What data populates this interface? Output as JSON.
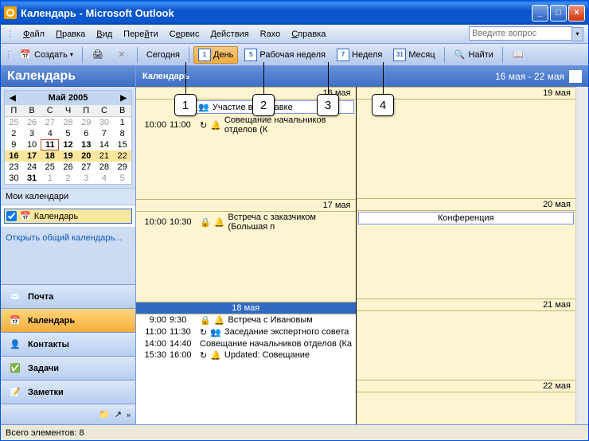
{
  "title": "Календарь - Microsoft Outlook",
  "menu": {
    "file": "Файл",
    "edit": "Правка",
    "view": "Вид",
    "go": "Перейти",
    "service": "Сервис",
    "actions": "Действия",
    "raxo": "Rахо",
    "help": "Справка"
  },
  "help_placeholder": "Введите вопрос",
  "toolbar": {
    "create": "Создать",
    "today": "Сегодня",
    "day_num": "1",
    "day": "День",
    "week5_num": "5",
    "workweek": "Рабочая неделя",
    "week7_num": "7",
    "week": "Неделя",
    "month_num": "31",
    "month": "Месяц",
    "find": "Найти"
  },
  "nav": {
    "header": "Календарь",
    "month": "Май 2005",
    "dow": [
      "П",
      "В",
      "С",
      "Ч",
      "П",
      "С",
      "В"
    ],
    "rows": [
      [
        {
          "d": "25",
          "dim": true
        },
        {
          "d": "26",
          "dim": true
        },
        {
          "d": "27",
          "dim": true
        },
        {
          "d": "28",
          "dim": true
        },
        {
          "d": "29",
          "dim": true
        },
        {
          "d": "30",
          "dim": true
        },
        {
          "d": "1"
        }
      ],
      [
        {
          "d": "2"
        },
        {
          "d": "3"
        },
        {
          "d": "4"
        },
        {
          "d": "5"
        },
        {
          "d": "6"
        },
        {
          "d": "7"
        },
        {
          "d": "8"
        }
      ],
      [
        {
          "d": "9"
        },
        {
          "d": "10"
        },
        {
          "d": "11",
          "today": true,
          "busy": true
        },
        {
          "d": "12",
          "busy": true
        },
        {
          "d": "13",
          "busy": true
        },
        {
          "d": "14"
        },
        {
          "d": "15"
        }
      ],
      [
        {
          "d": "16",
          "hl": true,
          "busy": true
        },
        {
          "d": "17",
          "hl": true,
          "busy": true
        },
        {
          "d": "18",
          "hl": true,
          "busy": true
        },
        {
          "d": "19",
          "hl": true,
          "busy": true
        },
        {
          "d": "20",
          "hl": true,
          "busy": true
        },
        {
          "d": "21",
          "hl": true
        },
        {
          "d": "22",
          "hl": true
        }
      ],
      [
        {
          "d": "23"
        },
        {
          "d": "24"
        },
        {
          "d": "25"
        },
        {
          "d": "26"
        },
        {
          "d": "27"
        },
        {
          "d": "28"
        },
        {
          "d": "29"
        }
      ],
      [
        {
          "d": "30"
        },
        {
          "d": "31",
          "busy": true
        },
        {
          "d": "1",
          "dim": true
        },
        {
          "d": "2",
          "dim": true
        },
        {
          "d": "3",
          "dim": true
        },
        {
          "d": "4",
          "dim": true
        },
        {
          "d": "5",
          "dim": true
        }
      ]
    ],
    "mycal_hdr": "Мои календари",
    "mycal_item": "Календарь",
    "open_shared": "Открыть общий календарь..."
  },
  "navbtns": {
    "mail": "Почта",
    "calendar": "Календарь",
    "contacts": "Контакты",
    "tasks": "Задачи",
    "notes": "Заметки"
  },
  "content": {
    "header": "Календарь",
    "daterange": "16 мая - 22 мая",
    "d16": "16 мая",
    "d17": "17 мая",
    "d18": "18 мая",
    "d19": "19 мая",
    "d20": "20 мая",
    "d21": "21 мая",
    "d22": "22 мая",
    "a16_full": "Участие в выставке",
    "a16_t1": "10:00",
    "a16_t2": "11:00",
    "a16_s": "Совещание начальников отделов (К",
    "a17_t1": "10:00",
    "a17_t2": "10:30",
    "a17_s": "Встреча с заказчиком (Большая п",
    "a18a_t1": "9:00",
    "a18a_t2": "9:30",
    "a18a_s": "Встреча с Ивановым",
    "a18b_t1": "11:00",
    "a18b_t2": "11:30",
    "a18b_s": "Заседание экспертного совета",
    "a18c_t1": "14:00",
    "a18c_t2": "14:40",
    "a18c_s": "Совещание начальников отделов (Ка",
    "a18d_t1": "15:30",
    "a18d_t2": "16:00",
    "a18d_s": "Updated: Совещание",
    "a20_full": "Конференция"
  },
  "status": "Всего элементов: 8",
  "callouts": {
    "c1": "1",
    "c2": "2",
    "c3": "3",
    "c4": "4"
  }
}
